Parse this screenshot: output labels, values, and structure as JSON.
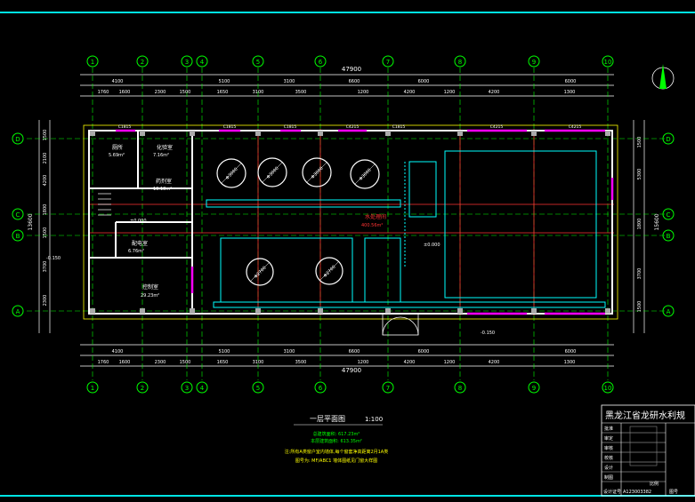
{
  "colors": {
    "background": "#000000",
    "axis": "#00ff00",
    "wall": "#ffffff",
    "dim_text": "#ffffff",
    "window": "#ff00ff",
    "room_line": "#ff3333",
    "tank": "#00ffff",
    "title_block": "#ffffff",
    "note": "#ffff00",
    "frame": "#00e5e5"
  },
  "axes": {
    "vertical": [
      "1",
      "2",
      "3",
      "4",
      "5",
      "6",
      "7",
      "8",
      "9",
      "10"
    ],
    "horizontal": [
      "A",
      "B",
      "C",
      "D"
    ]
  },
  "dims": {
    "total": "47900",
    "top_row1": [
      "4100",
      "5100",
      "3100",
      "6600",
      "6000",
      "6000"
    ],
    "top_row2": [
      "1760",
      "1600",
      "2300",
      "1500",
      "1650",
      "3100",
      "3500",
      "1200",
      "4200",
      "1200",
      "4200",
      "1300"
    ],
    "side_left": [
      "1500",
      "2100",
      "4200",
      "1800",
      "1500",
      "3700",
      "2300"
    ],
    "side_right": [
      "1500",
      "5300",
      "1800",
      "3700",
      "1500"
    ],
    "height_total": "15600",
    "height_left": "13600"
  },
  "rooms": {
    "room1": "厕所",
    "room1_area": "5.69m²",
    "room2": "化验室",
    "room2_area": "7.16m²",
    "room3": "药剂室",
    "room3_area": "13.18m²",
    "room4": "配电室",
    "room4_area": "6.76m²",
    "room5": "控制室",
    "room5_area": "29.23m²",
    "main": "水处理间",
    "main_area": "400.56m²"
  },
  "windows": [
    "C1815",
    "C1815",
    "C1815",
    "C4215",
    "C1815",
    "C4215",
    "C4215"
  ],
  "tanks": [
    "Φ3000",
    "Φ3000",
    "Φ3000",
    "Φ3000",
    "Φ2700",
    "Φ2700"
  ],
  "elevations": [
    "±0.000",
    "±0.000",
    "-0.150",
    "-0.150"
  ],
  "drawing": {
    "title": "一层平面图",
    "scale": "1:100",
    "notes": [
      "总建筑面积: 617.23m²",
      "本层建筑面积: 613.35m²",
      "注:所有A类窗户室内墙体,每个窗套净高距离2月1A类",
      "图号为: MF/ABC1 墙体图纸见门窗大样图"
    ]
  },
  "title_block": {
    "company": "黑龙江省龙研水利规",
    "rows": [
      "批准",
      "审定",
      "审核",
      "校核",
      "设计",
      "制图"
    ],
    "bottom_label": "设计证号",
    "bottom_value": "A123003382",
    "scale_label": "比例",
    "no_label": "图号"
  }
}
